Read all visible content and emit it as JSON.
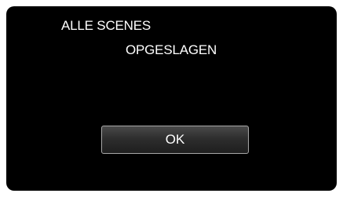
{
  "dialog": {
    "message_line_1": "ALLE SCENES",
    "message_line_2": "OPGESLAGEN",
    "ok_label": "OK"
  },
  "colors": {
    "background": "#000000",
    "text": "#ffffff",
    "button_border": "#a8a8a8"
  }
}
